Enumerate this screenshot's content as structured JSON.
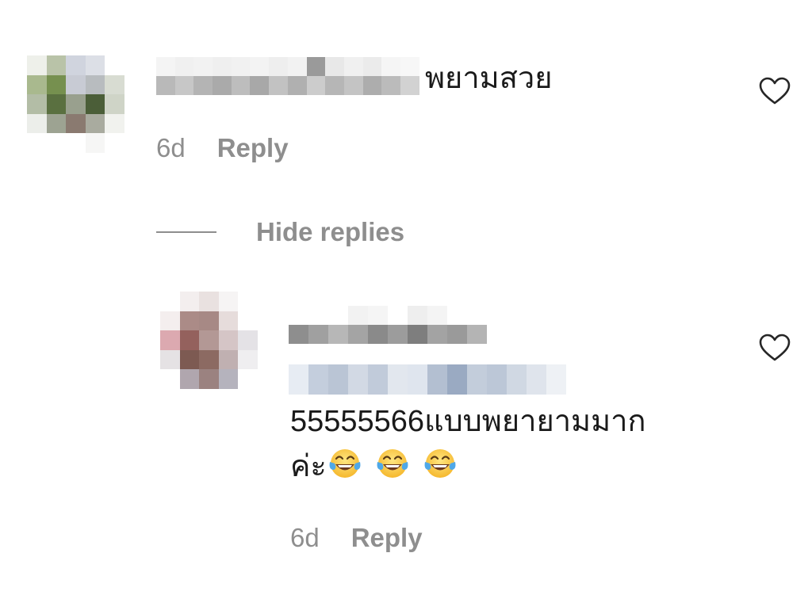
{
  "comments": [
    {
      "text": "พยามสวย",
      "time": "6d",
      "reply_label": "Reply"
    }
  ],
  "thread": {
    "hide_replies_label": "Hide replies"
  },
  "replies": [
    {
      "text_line1": "55555566แบบพยายามมาก",
      "text_line2": "ค่ะ",
      "emoji_name": "face-with-tears-of-joy",
      "emoji_count": 3,
      "time": "6d",
      "reply_label": "Reply"
    }
  ],
  "icons": {
    "like": "heart-outline-icon"
  },
  "colors": {
    "secondary_text": "#8e8e8e",
    "primary_text": "#1a1a1a"
  }
}
